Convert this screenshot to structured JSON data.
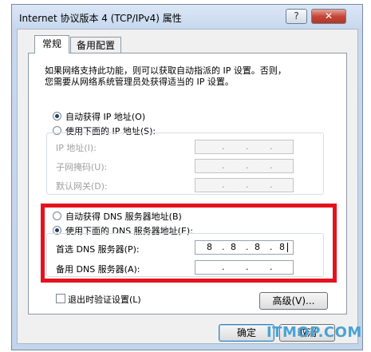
{
  "window": {
    "title": "Internet 协议版本 4 (TCP/IPv4) 属性",
    "help_label": "?",
    "close_label": "✕"
  },
  "tabs": [
    {
      "label": "常规"
    },
    {
      "label": "备用配置"
    }
  ],
  "general": {
    "description_line1": "如果网络支持此功能，则可以获取自动指派的 IP 设置。否则，",
    "description_line2": "您需要从网络系统管理员处获得适当的 IP 设置。",
    "auto_ip_label": "自动获得 IP 地址(O)",
    "manual_ip_label": "使用下面的 IP 地址(S):",
    "ip_address_label": "IP 地址(I):",
    "subnet_label": "子网掩码(U):",
    "gateway_label": "默认网关(D):",
    "auto_dns_label": "自动获得 DNS 服务器地址(B)",
    "manual_dns_label": "使用下面的 DNS 服务器地址(E):",
    "preferred_dns_label": "首选 DNS 服务器(P):",
    "alternate_dns_label": "备用 DNS 服务器(A):",
    "preferred_dns": [
      "8",
      "8",
      "8",
      "8"
    ],
    "validate_label": "退出时验证设置(L)",
    "advanced_label": "高级(V)..."
  },
  "footer": {
    "ok_label": "确定",
    "cancel_label": "取消"
  },
  "watermark": "ITMOP.COM",
  "colors": {
    "highlight_border": "#e5121d",
    "close_button": "#c3483a"
  }
}
